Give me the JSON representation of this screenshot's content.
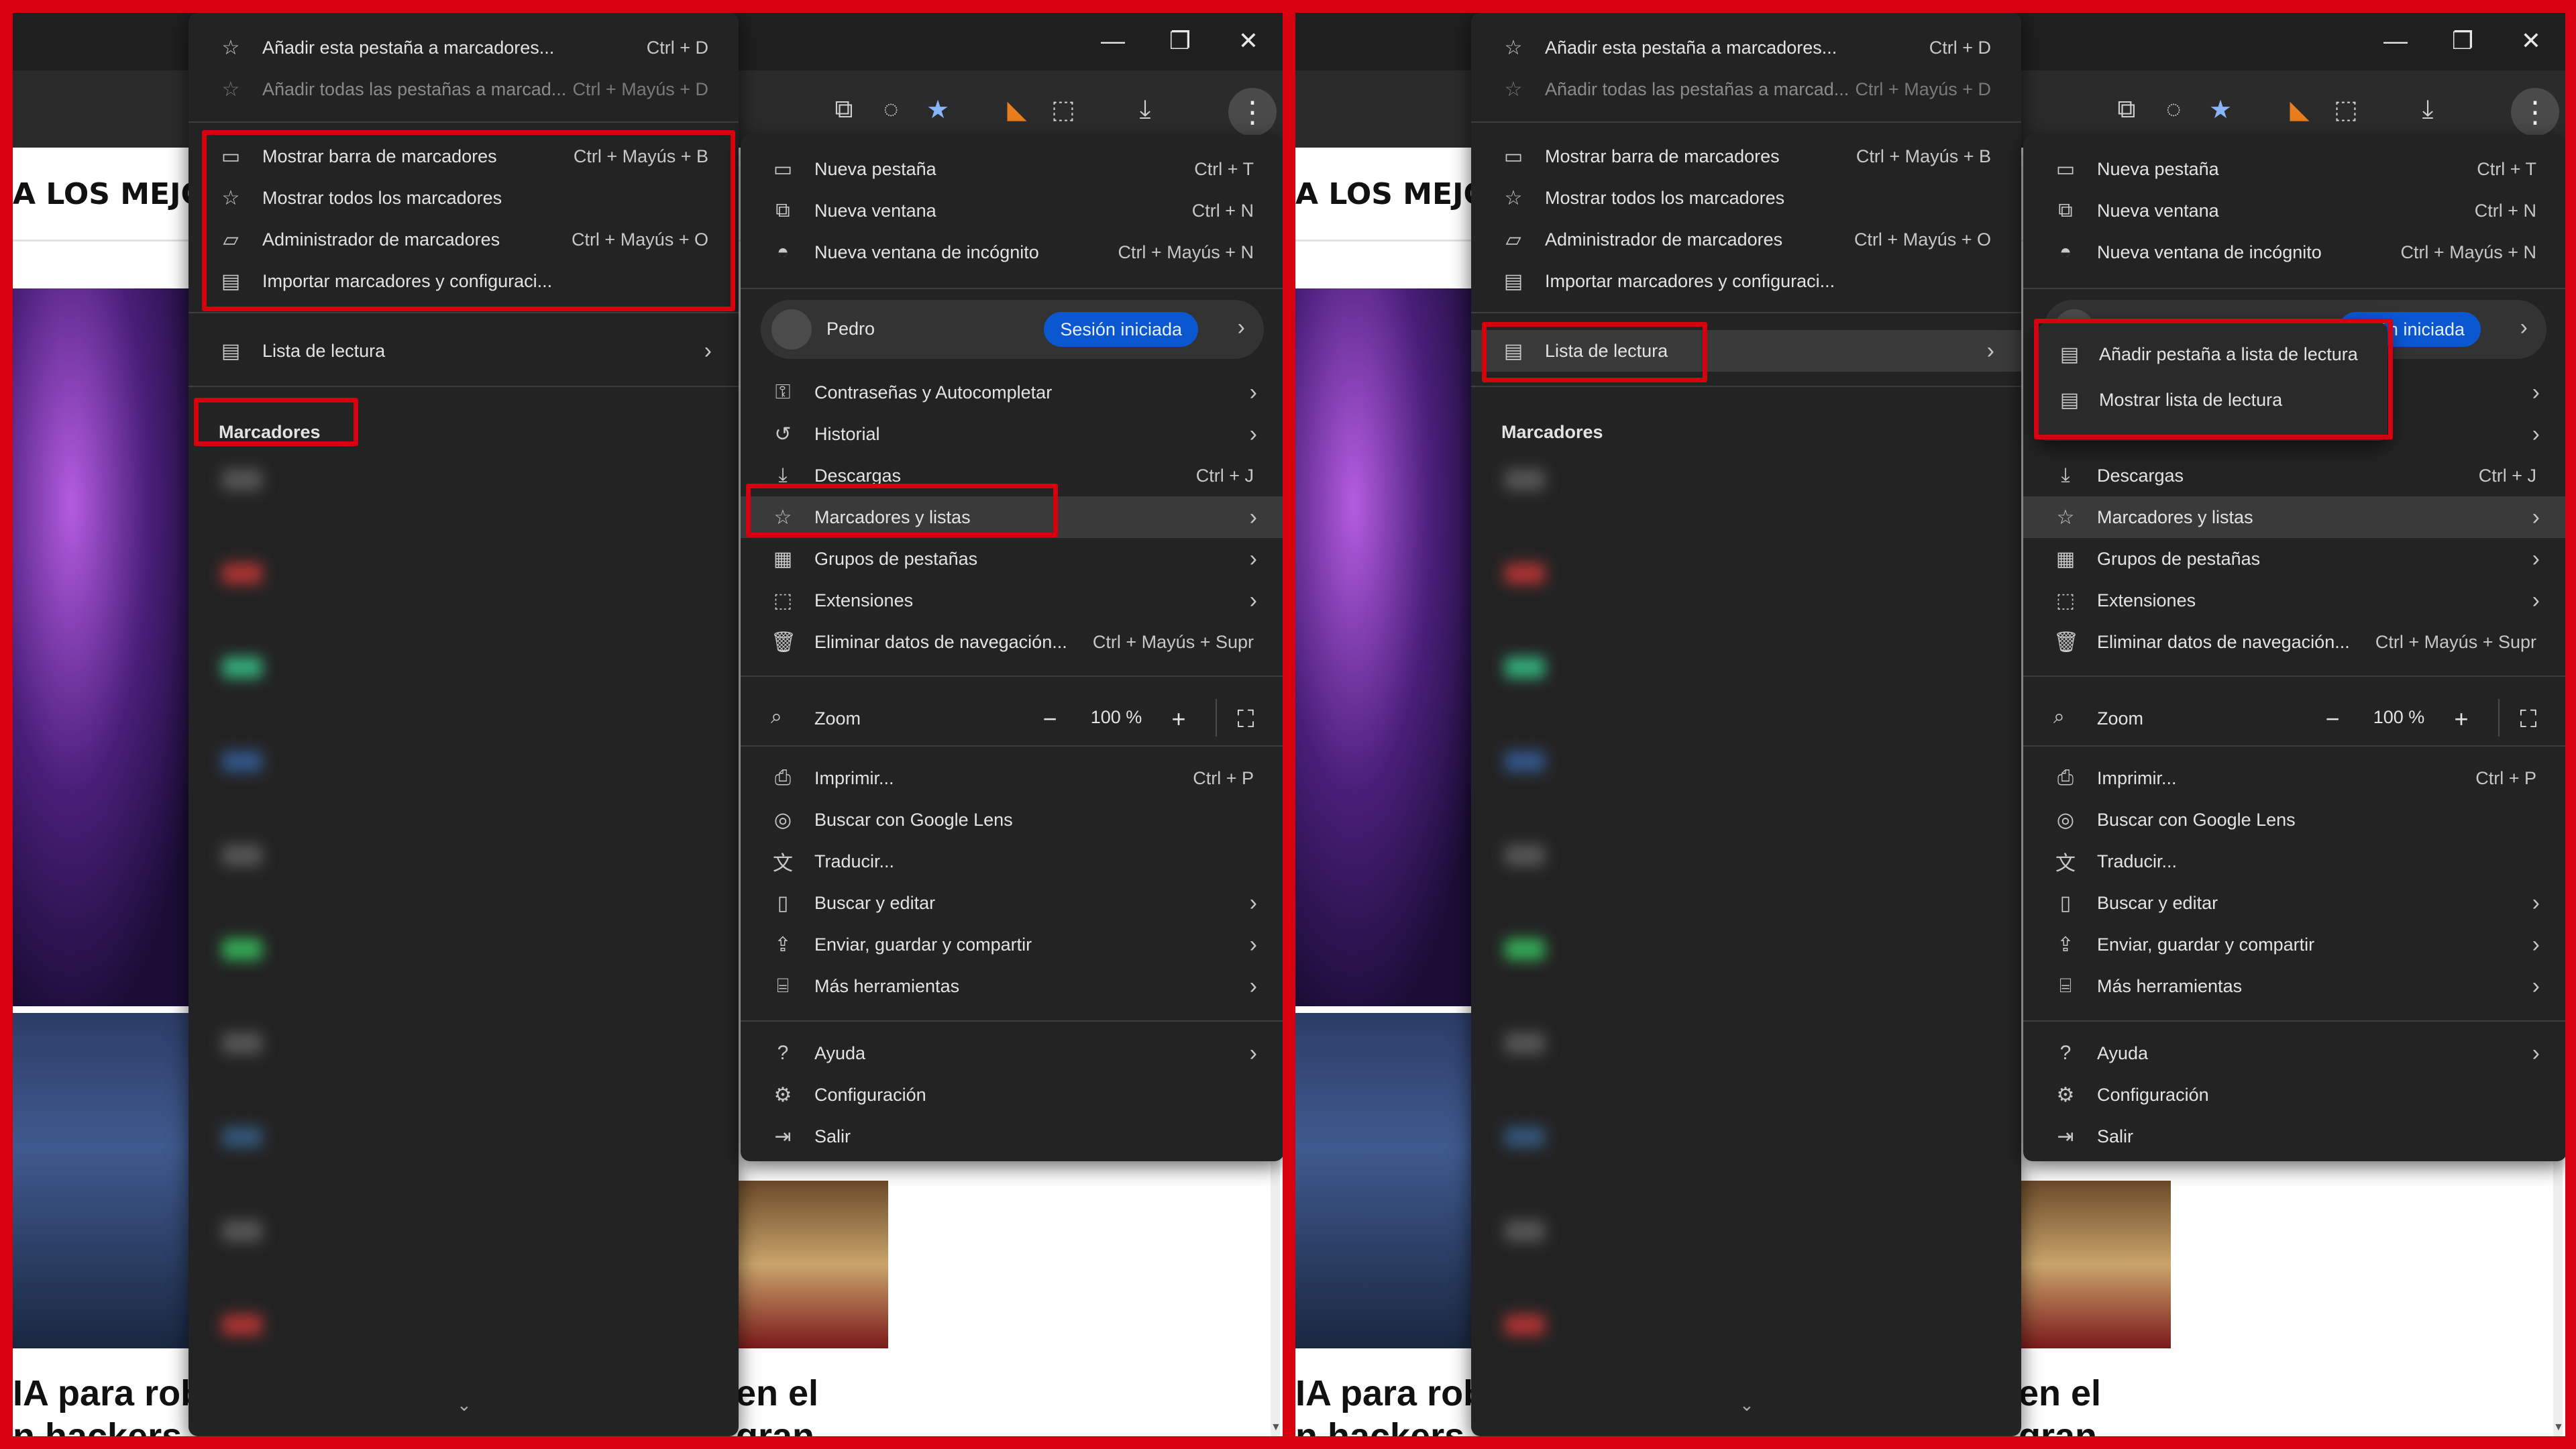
{
  "panels": [
    {
      "id": "left",
      "site_heading": "A   LOS MEJO",
      "news_title_left": [
        "IA para rob",
        "n hackers"
      ],
      "news_title_right": [
        "en el",
        "gran"
      ],
      "bookmarks_menu": {
        "items": [
          {
            "label": "Añadir esta pestaña a marcadores...",
            "shortcut": "Ctrl + D",
            "icon": "star-outline-icon"
          },
          {
            "label": "Añadir todas las pestañas a marcad...",
            "shortcut": "Ctrl + Mayús + D",
            "icon": "star-outline-icon",
            "disabled": true
          },
          {
            "label": "Mostrar barra de marcadores",
            "shortcut": "Ctrl + Mayús + B",
            "icon": "bookmark-bar-icon"
          },
          {
            "label": "Mostrar todos los marcadores",
            "shortcut": "",
            "icon": "star-outline-icon"
          },
          {
            "label": "Administrador de marcadores",
            "shortcut": "Ctrl + Mayús + O",
            "icon": "folder-icon"
          },
          {
            "label": "Importar marcadores y configuraci...",
            "shortcut": "",
            "icon": "import-icon"
          },
          {
            "label": "Lista de lectura",
            "shortcut": "",
            "icon": "reading-list-icon"
          }
        ],
        "section_title": "Marcadores"
      },
      "main_menu": {
        "items": [
          {
            "label": "Nueva pestaña",
            "shortcut": "Ctrl + T"
          },
          {
            "label": "Nueva ventana",
            "shortcut": "Ctrl + N"
          },
          {
            "label": "Nueva ventana de incógnito",
            "shortcut": "Ctrl + Mayús + N"
          }
        ],
        "profile_name": "Pedro",
        "profile_badge": "Sesión iniciada",
        "items2": [
          {
            "label": "Contraseñas y Autocompletar",
            "shortcut": ""
          },
          {
            "label": "Historial",
            "shortcut": ""
          },
          {
            "label": "Descargas",
            "shortcut": "Ctrl + J"
          },
          {
            "label": "Marcadores y listas",
            "shortcut": ""
          },
          {
            "label": "Grupos de pestañas",
            "shortcut": ""
          },
          {
            "label": "Extensiones",
            "shortcut": ""
          },
          {
            "label": "Eliminar datos de navegación...",
            "shortcut": "Ctrl + Mayús + Supr"
          }
        ],
        "zoom_label": "Zoom",
        "zoom_value": "100 %",
        "zoom_minus": "−",
        "zoom_plus": "+",
        "items3": [
          {
            "label": "Imprimir...",
            "shortcut": "Ctrl + P"
          },
          {
            "label": "Buscar con Google Lens",
            "shortcut": ""
          },
          {
            "label": "Traducir...",
            "shortcut": ""
          },
          {
            "label": "Buscar y editar",
            "shortcut": ""
          },
          {
            "label": "Enviar, guardar y compartir",
            "shortcut": ""
          },
          {
            "label": "Más herramientas",
            "shortcut": ""
          }
        ],
        "items4": [
          {
            "label": "Ayuda",
            "shortcut": ""
          },
          {
            "label": "Configuración",
            "shortcut": ""
          },
          {
            "label": "Salir",
            "shortcut": ""
          }
        ]
      }
    },
    {
      "id": "right",
      "site_heading": "A   LOS MEJO",
      "news_title_left": [
        "IA para rob",
        "n hackers"
      ],
      "news_title_right": [
        "en el",
        "gran"
      ],
      "bookmarks_menu": {
        "items": [
          {
            "label": "Añadir esta pestaña a marcadores...",
            "shortcut": "Ctrl + D"
          },
          {
            "label": "Añadir todas las pestañas a marcad...",
            "shortcut": "Ctrl + Mayús + D"
          },
          {
            "label": "Mostrar barra de marcadores",
            "shortcut": "Ctrl + Mayús + B"
          },
          {
            "label": "Mostrar todos los marcadores",
            "shortcut": ""
          },
          {
            "label": "Administrador de marcadores",
            "shortcut": "Ctrl + Mayús + O"
          },
          {
            "label": "Importar marcadores y configuraci...",
            "shortcut": ""
          },
          {
            "label": "Lista de lectura",
            "shortcut": ""
          }
        ],
        "section_title": "Marcadores"
      },
      "submenu": {
        "items": [
          {
            "label": "Añadir pestaña a lista de lectura"
          },
          {
            "label": "Mostrar lista de lectura"
          }
        ]
      },
      "main_menu": {
        "items": [
          {
            "label": "Nueva pestaña",
            "shortcut": "Ctrl + T"
          },
          {
            "label": "Nueva ventana",
            "shortcut": "Ctrl + N"
          },
          {
            "label": "Nueva ventana de incógnito",
            "shortcut": "Ctrl + Mayús + N"
          }
        ],
        "profile_badge": "esión iniciada",
        "items2": [
          {
            "label": "Descargas",
            "shortcut": "Ctrl + J"
          },
          {
            "label": "Marcadores y listas",
            "shortcut": ""
          },
          {
            "label": "Grupos de pestañas",
            "shortcut": ""
          },
          {
            "label": "Extensiones",
            "shortcut": ""
          },
          {
            "label": "Eliminar datos de navegación...",
            "shortcut": "Ctrl + Mayús + Supr"
          }
        ],
        "zoom_label": "Zoom",
        "zoom_value": "100 %",
        "zoom_minus": "−",
        "zoom_plus": "+",
        "items3": [
          {
            "label": "Imprimir...",
            "shortcut": "Ctrl + P"
          },
          {
            "label": "Buscar con Google Lens",
            "shortcut": ""
          },
          {
            "label": "Traducir...",
            "shortcut": ""
          },
          {
            "label": "Buscar y editar",
            "shortcut": ""
          },
          {
            "label": "Enviar, guardar y compartir",
            "shortcut": ""
          },
          {
            "label": "Más herramientas",
            "shortcut": ""
          }
        ],
        "items4": [
          {
            "label": "Ayuda",
            "shortcut": ""
          },
          {
            "label": "Configuración",
            "shortcut": ""
          },
          {
            "label": "Salir",
            "shortcut": ""
          }
        ]
      }
    }
  ],
  "colors": {
    "highlight": "#d7000f",
    "badge": "#0b57d0",
    "menu_bg": "#232323"
  }
}
